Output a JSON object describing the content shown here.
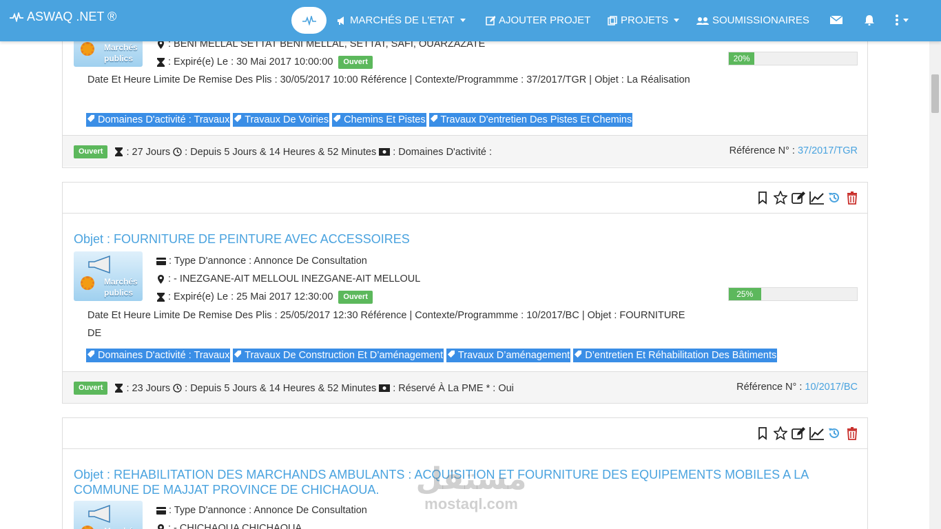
{
  "navbar": {
    "brand": "ASWAQ .NET ®",
    "menu": {
      "marches": "MARCHÉS DE L'ETAT",
      "ajouter": "AJOUTER PROJET",
      "projets": "PROJETS",
      "soumissionaires": "SOUMISSIONAIRES"
    },
    "accent_color": "#4aa3df"
  },
  "thumb_label": [
    "Marchés",
    "publics"
  ],
  "panels": [
    {
      "location": ": BENI MELLAL SETTAT BENI MELLAL, SETTAT, SAFI, OUARZAZATE",
      "expire": ": Expiré(e) Le : 30 Mai 2017 10:00:00",
      "status": "Ouvert",
      "progress_percent": 20,
      "progress_label": "20%",
      "description": "Date Et Heure Limite De Remise Des Plis : 30/05/2017 10:00 Référence | Contexte/Programmme : 37/2017/TGR | Objet : La Réalisation",
      "tags": [
        "Domaines D'activité : Travaux",
        "Travaux De Voiries",
        "Chemins Et Pistes",
        "Travaux D'entretien Des Pistes Et Chemins"
      ],
      "footer": {
        "status": "Ouvert",
        "days": ": 27 Jours",
        "since": ": Depuis 5 Jours & 14 Heures & 52 Minutes",
        "extra": ": Domaines D'activité :",
        "ref_label": "Référence N° :",
        "ref_value": "37/2017/TGR"
      }
    },
    {
      "title": "Objet : FOURNITURE DE PEINTURE AVEC ACCESSOIRES",
      "type": ": Type D'annonce : Annonce De Consultation",
      "location": ": - INEZGANE-AIT MELLOUL INEZGANE-AIT MELLOUL",
      "expire": ": Expiré(e) Le : 25 Mai 2017 12:30:00",
      "status": "Ouvert",
      "progress_percent": 25,
      "progress_label": "25%",
      "description": "Date Et Heure Limite De Remise Des Plis : 25/05/2017 12:30 Référence | Contexte/Programmme : 10/2017/BC | Objet : FOURNITURE DE",
      "tags": [
        "Domaines D'activité : Travaux",
        "Travaux De Construction Et D’aménagement",
        "Travaux D’aménagement",
        "D’entretien Et Réhabilitation Des Bâtiments"
      ],
      "footer": {
        "status": "Ouvert",
        "days": ": 23 Jours",
        "since": ": Depuis 5 Jours & 14 Heures & 52 Minutes",
        "extra": ": Réservé À La PME * : Oui",
        "ref_label": "Référence N° :",
        "ref_value": "10/2017/BC"
      }
    },
    {
      "title": "Objet : REHABILITATION DES MARCHANDS AMBULANTS : ACQUISITION ET FOURNITURE DES EQUIPEMENTS MOBILES A LA COMMUNE DE MAJJAT PROVINCE DE CHICHAOUA.",
      "type": ": Type D'annonce : Annonce De Consultation",
      "location": ": - CHICHAOUA CHICHAOUA"
    }
  ],
  "watermark": {
    "ar": "مستقل",
    "en": "mostaql.com"
  }
}
